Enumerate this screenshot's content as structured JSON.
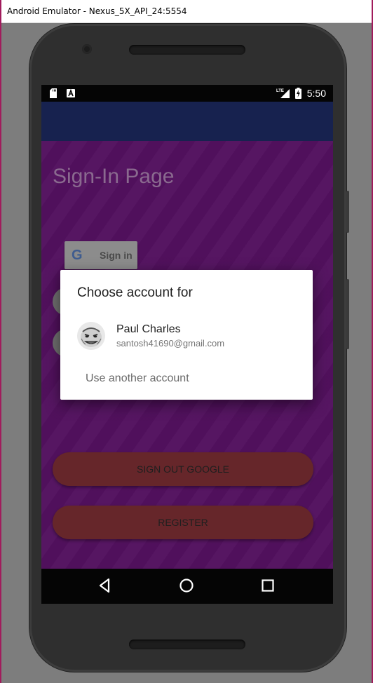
{
  "window": {
    "title": "Android Emulator - Nexus_5X_API_24:5554"
  },
  "statusbar": {
    "time": "5:50",
    "network": "LTE"
  },
  "page": {
    "title": "Sign-In Page",
    "google_signin_label": "Sign in",
    "signout_label": "SIGN OUT GOOGLE",
    "register_label": "REGISTER"
  },
  "dialog": {
    "title": "Choose account for",
    "account": {
      "name": "Paul Charles",
      "email": "santosh41690@gmail.com"
    },
    "use_another": "Use another account"
  },
  "icons": [
    "sd-card-icon",
    "app-notification-icon",
    "lte-signal-icon",
    "battery-charging-icon",
    "back-icon",
    "home-icon",
    "recents-icon",
    "google-g-icon",
    "avatar"
  ],
  "colors": {
    "app_bar": "#17224f",
    "content_bg": "#53115f",
    "pill_button": "#66262a",
    "dialog_bg": "#ffffff"
  }
}
